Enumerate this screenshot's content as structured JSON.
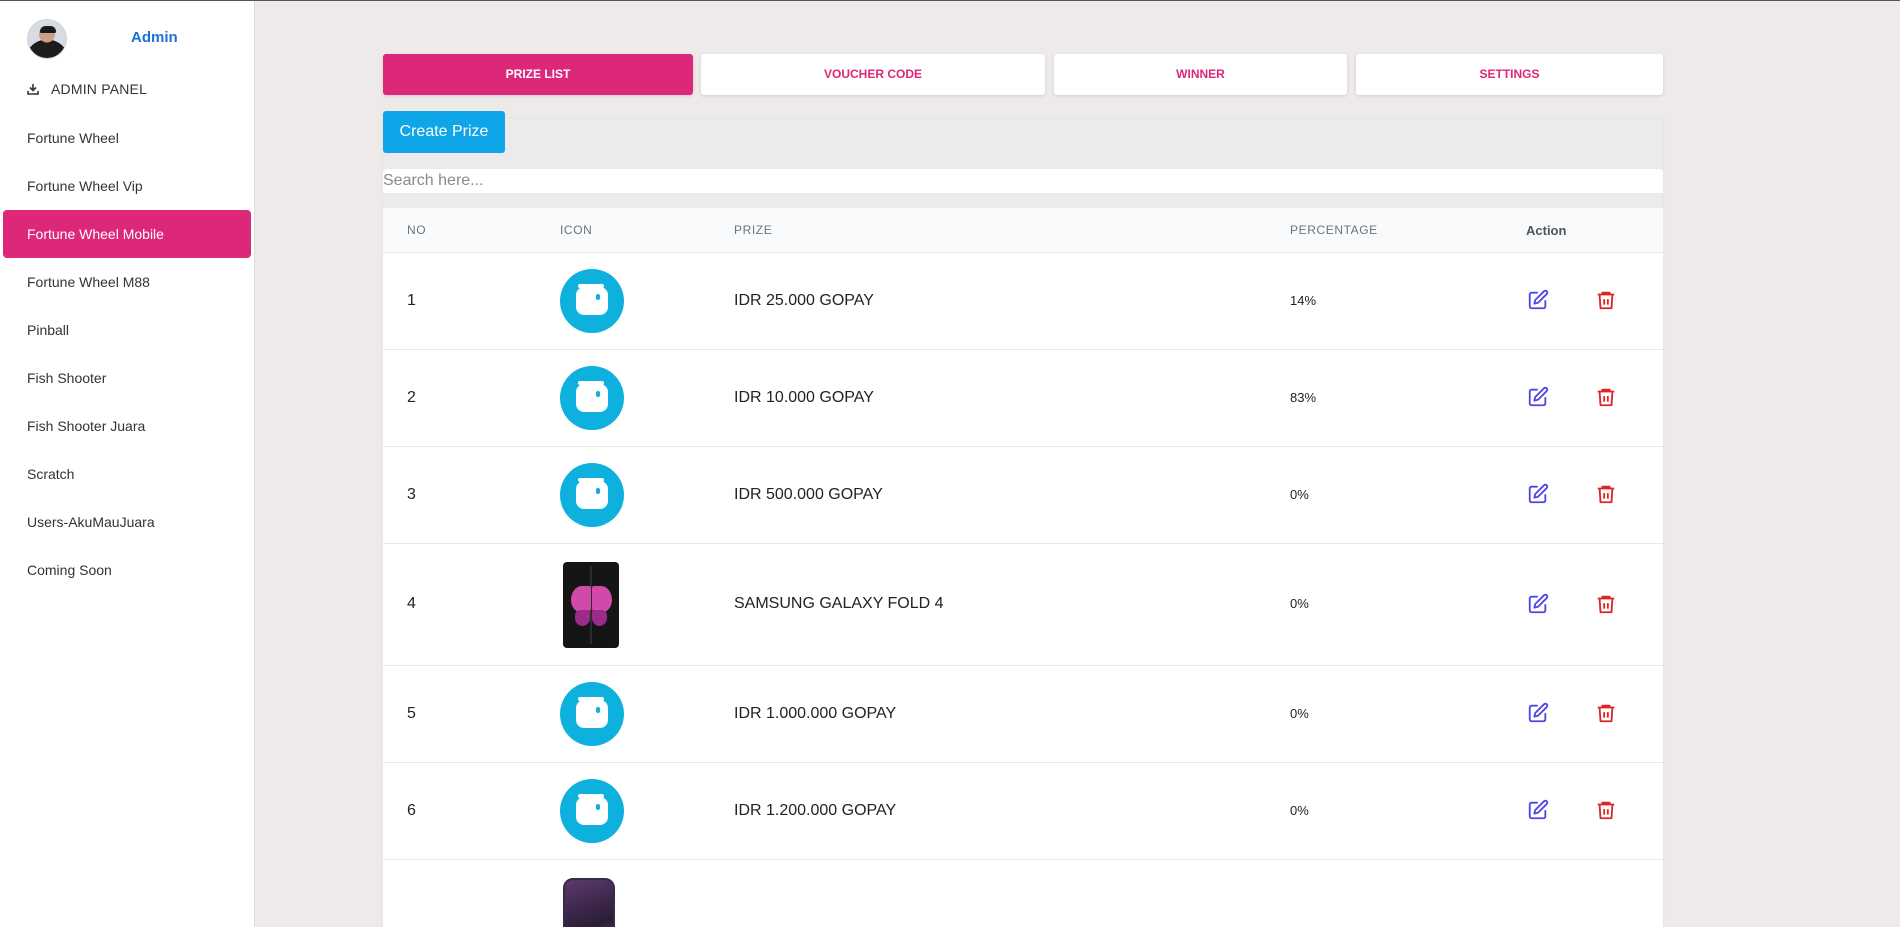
{
  "sidebar": {
    "admin_name": "Admin",
    "panel_title": "ADMIN PANEL",
    "items": [
      {
        "label": "Fortune Wheel"
      },
      {
        "label": "Fortune Wheel Vip"
      },
      {
        "label": "Fortune Wheel Mobile",
        "active": true
      },
      {
        "label": "Fortune Wheel M88"
      },
      {
        "label": "Pinball"
      },
      {
        "label": "Fish Shooter"
      },
      {
        "label": "Fish Shooter Juara"
      },
      {
        "label": "Scratch"
      },
      {
        "label": "Users-AkuMauJuara"
      },
      {
        "label": "Coming Soon"
      }
    ]
  },
  "tabs": [
    {
      "label": "PRIZE LIST",
      "active": true
    },
    {
      "label": "VOUCHER CODE"
    },
    {
      "label": "WINNER"
    },
    {
      "label": "SETTINGS"
    }
  ],
  "create_button": "Create Prize",
  "search": {
    "placeholder": "Search here...",
    "value": ""
  },
  "table": {
    "headers": {
      "no": "NO",
      "icon": "ICON",
      "prize": "PRIZE",
      "percentage": "PERCENTAGE",
      "action": "Action"
    },
    "rows": [
      {
        "no": "1",
        "icon": "wallet-icon",
        "prize": "IDR 25.000 GOPAY",
        "percentage": "14%"
      },
      {
        "no": "2",
        "icon": "wallet-icon",
        "prize": "IDR 10.000 GOPAY",
        "percentage": "83%"
      },
      {
        "no": "3",
        "icon": "wallet-icon",
        "prize": "IDR 500.000 GOPAY",
        "percentage": "0%"
      },
      {
        "no": "4",
        "icon": "phone-fold-image",
        "prize": "SAMSUNG GALAXY FOLD 4",
        "percentage": "0%"
      },
      {
        "no": "5",
        "icon": "wallet-icon",
        "prize": "IDR 1.000.000 GOPAY",
        "percentage": "0%"
      },
      {
        "no": "6",
        "icon": "wallet-icon",
        "prize": "IDR 1.200.000 GOPAY",
        "percentage": "0%"
      },
      {
        "no": "",
        "icon": "iphone-image",
        "prize": "",
        "percentage": ""
      }
    ]
  },
  "colors": {
    "accent": "#dd2779",
    "button_blue": "#0ea5e9",
    "edit_icon": "#4f46e5",
    "delete_icon": "#dc2626",
    "wallet_bg": "#0eb0de"
  }
}
